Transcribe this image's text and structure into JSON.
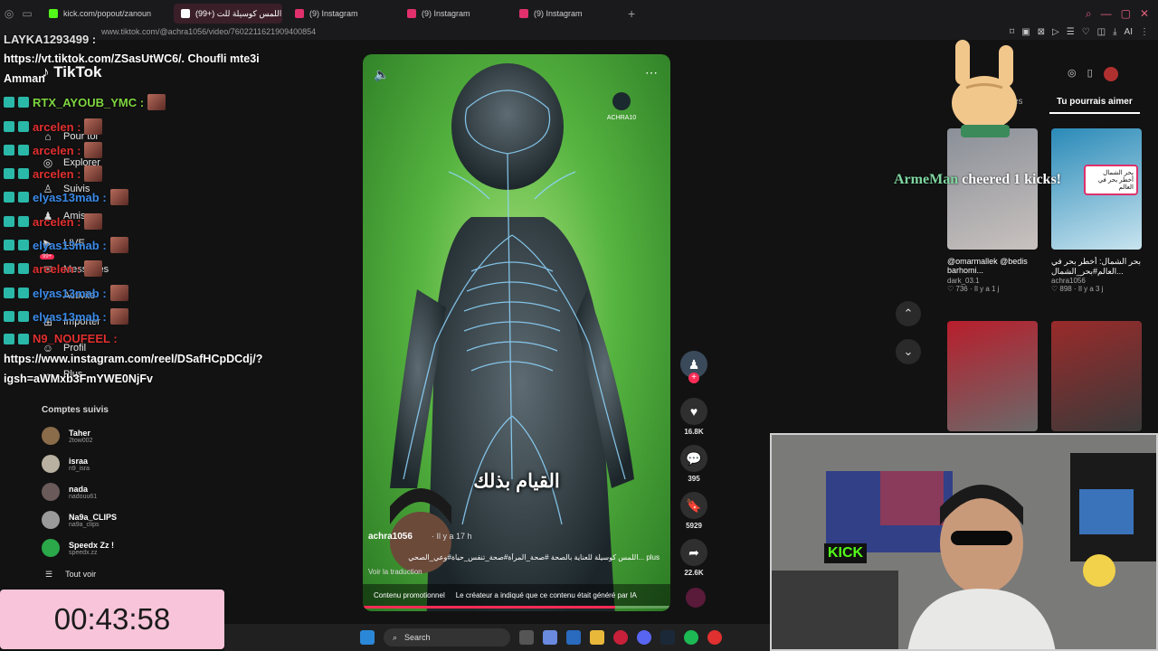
{
  "browser": {
    "tabs": [
      {
        "label": "kick.com/popout/zanoun",
        "color": "#53fc18"
      },
      {
        "label": "(99+) اللمس كوسيلة للت",
        "color": "#ffffff",
        "active": true
      },
      {
        "label": "(9) Instagram",
        "color": "#e1306c"
      },
      {
        "label": "(9) Instagram",
        "color": "#e1306c"
      },
      {
        "label": "(9) Instagram",
        "color": "#e1306c"
      }
    ],
    "url": "www.tiktok.com/@achra1056/video/7602211621909400854",
    "toolbar_ai": "AI"
  },
  "tiktok": {
    "logo": "TikTok",
    "nav": [
      {
        "label": "Pour toi",
        "icon": "home-icon"
      },
      {
        "label": "Explorer",
        "icon": "compass-icon"
      },
      {
        "label": "Suivis",
        "icon": "following-icon"
      },
      {
        "label": "Amis",
        "icon": "friends-icon"
      },
      {
        "label": "LIVE",
        "icon": "live-icon"
      },
      {
        "label": "Messages",
        "icon": "message-icon",
        "badge": "99+"
      },
      {
        "label": "Activité",
        "icon": "activity-icon"
      },
      {
        "label": "Importer",
        "icon": "upload-icon"
      },
      {
        "label": "Profil",
        "icon": "profile-icon"
      },
      {
        "label": "Plus",
        "icon": "more-icon"
      }
    ],
    "following_title": "Comptes suivis",
    "following": [
      {
        "name": "Taher",
        "handle": "2tow002",
        "color": "#8a6b4a"
      },
      {
        "name": "israa",
        "handle": "n9_isra",
        "color": "#b8b0a0"
      },
      {
        "name": "nada",
        "handle": "nadouu61",
        "color": "#6a5a5a"
      },
      {
        "name": "Na9a_CLIPS",
        "handle": "na9a_clips",
        "color": "#9a9a9a"
      },
      {
        "name": "Speedx Zz !",
        "handle": "speedx.zz",
        "color": "#2aa84a"
      }
    ],
    "see_all": "Tout voir",
    "video": {
      "caption_ar": "القيام بذلك",
      "author": "achra1056",
      "age": "· Il y a 17 h",
      "description": "اللمس كوسيلة للعناية بالصحة #صحة_المرأة#صحة_تنفس_حياة#وعي_الصحي... plus",
      "translate": "Voir la traduction",
      "promo": "Contenu promotionnel",
      "ai_label": "Le créateur a indiqué que ce contenu était généré par IA",
      "watermark": "ACHRA10",
      "progress_pct": 82
    },
    "actions": [
      {
        "icon": "heart-icon",
        "count": "16.8K"
      },
      {
        "icon": "comment-icon",
        "count": "395"
      },
      {
        "icon": "bookmark-icon",
        "count": "5929"
      },
      {
        "icon": "share-icon",
        "count": "22.6K"
      }
    ],
    "right_tabs": {
      "other": "es",
      "active": "Tu pourrais aimer"
    },
    "suggestions": [
      {
        "title": "@omarmallek @bedis barhomi...",
        "user": "dark_03.1",
        "likes": "736",
        "age": "· Il y a 1 j",
        "colors": [
          "#8a8f98",
          "#c9c2bf"
        ]
      },
      {
        "title": "بحر الشمال: أخطر بحر في العالم#بحر_الشمال...",
        "user": "achra1056",
        "likes": "898",
        "age": "· Il y a 3 j",
        "colors": [
          "#2a8ab8",
          "#c8e4ef"
        ]
      },
      {
        "colors": [
          "#b81e2c",
          "#6a6a6a"
        ]
      },
      {
        "colors": [
          "#9a2a2a",
          "#3a3a3a"
        ]
      }
    ],
    "thumb_text_ar": "بحر الشمال أخطر بحر في العالم"
  },
  "chat": [
    {
      "user": "LAYKA1293499 :",
      "color": "#e0e0e0"
    },
    {
      "user": "RTX_AYOUB_YMC :",
      "color": "#7fd640"
    },
    {
      "user": "arcelen :",
      "color": "#e03030"
    },
    {
      "user": "arcelen :",
      "color": "#e03030"
    },
    {
      "user": "arcelen :",
      "color": "#e03030"
    },
    {
      "user": "elyas13mab :",
      "color": "#3a8ae8"
    },
    {
      "user": "arcelen :",
      "color": "#e03030"
    },
    {
      "user": "elyas13mab :",
      "color": "#3a8ae8"
    },
    {
      "user": "arcelen :",
      "color": "#e03030"
    },
    {
      "user": "elyas13mab :",
      "color": "#3a8ae8"
    },
    {
      "user": "elyas13mab :",
      "color": "#3a8ae8"
    },
    {
      "user": "N9_NOUFEEL :",
      "color": "#e03030"
    }
  ],
  "chat_messages": [
    "https://vt.tiktok.com/ZSasUtWC6/. Choufli mte3i",
    "Amman",
    "https://www.instagram.com/reel/DSafHCpDCdj/?",
    "igsh=aWMxb3FmYWE0NjFv"
  ],
  "overlay": {
    "cheer_user": "ArmeMan",
    "cheer_text": "cheered 1 kicks!",
    "timer": "00:43:58",
    "cam_sign": "KICK"
  },
  "taskbar": {
    "search": "Search"
  }
}
